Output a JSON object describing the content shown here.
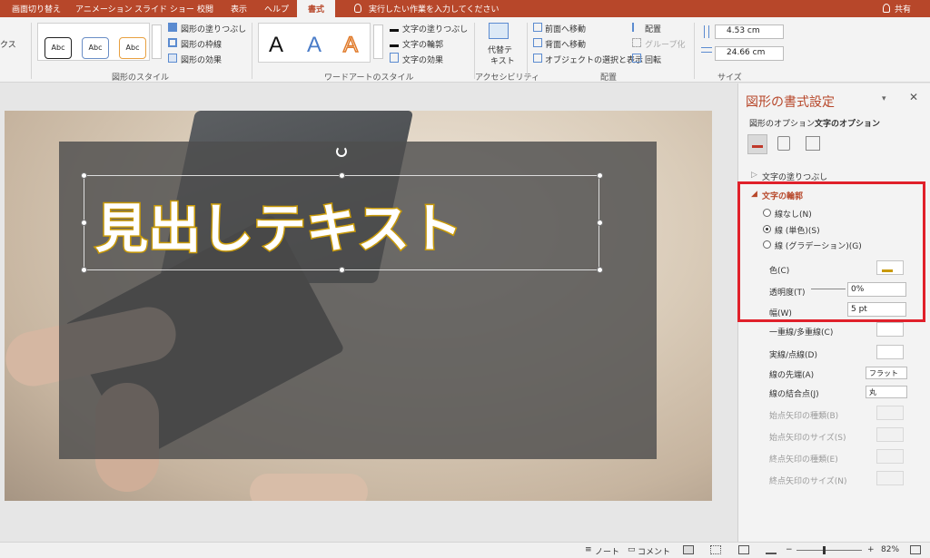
{
  "tabs": {
    "transitions": "画面切り替え",
    "animations": "アニメーション",
    "slideshow": "スライド ショー",
    "review": "校閲",
    "view": "表示",
    "help": "ヘルプ",
    "format": "書式",
    "tellme": "実行したい作業を入力してください",
    "share": "共有"
  },
  "ribbon": {
    "left_cut": "クス",
    "shape_styles": {
      "sample": "Abc",
      "fill": "図形の塗りつぶし",
      "outline": "図形の枠線",
      "effects": "図形の効果",
      "group_label": "図形のスタイル"
    },
    "wordart": {
      "letter": "A",
      "text_fill": "文字の塗りつぶし",
      "text_outline": "文字の輪郭",
      "text_effects": "文字の効果",
      "group_label": "ワードアートのスタイル"
    },
    "accessibility": {
      "alt_text_line1": "代替テ",
      "alt_text_line2": "キスト",
      "group_label": "アクセシビリティ"
    },
    "arrange": {
      "bring_forward": "前面へ移動",
      "send_backward": "背面へ移動",
      "selection_pane": "オブジェクトの選択と表示",
      "align": "配置",
      "group": "グループ化",
      "rotate": "回転",
      "group_label": "配置"
    },
    "size": {
      "height": "4.53 cm",
      "width": "24.66 cm",
      "group_label": "サイズ"
    }
  },
  "slide": {
    "headline": "見出しテキスト"
  },
  "panel": {
    "title": "図形の書式設定",
    "tab_shape": "図形のオプション",
    "tab_text": "文字のオプション",
    "text_fill_section": "文字の塗りつぶし",
    "text_outline_section": "文字の輪郭",
    "no_line": "線なし(N)",
    "solid_line": "線 (単色)(S)",
    "gradient_line": "線 (グラデーション)(G)",
    "color": "色(C)",
    "transparency": "透明度(T)",
    "transparency_value": "0%",
    "width": "幅(W)",
    "width_value": "5 pt",
    "compound": "一重線/多重線(C)",
    "dash": "実線/点線(D)",
    "cap": "線の先端(A)",
    "cap_value": "フラット",
    "join": "線の結合点(J)",
    "join_value": "丸",
    "begin_arrow_type": "始点矢印の種類(B)",
    "begin_arrow_size": "始点矢印のサイズ(S)",
    "end_arrow_type": "終点矢印の種類(E)",
    "end_arrow_size": "終点矢印のサイズ(N)"
  },
  "status": {
    "notes": "ノート",
    "comments": "コメント",
    "zoom": "82%"
  },
  "colors": {
    "accent": "#b7472a",
    "outline": "#c99a08",
    "highlight": "#e0202a"
  },
  "icons": [
    "search-icon",
    "user-icon",
    "rotate-handle-icon",
    "pen-color-icon",
    "close-icon"
  ]
}
